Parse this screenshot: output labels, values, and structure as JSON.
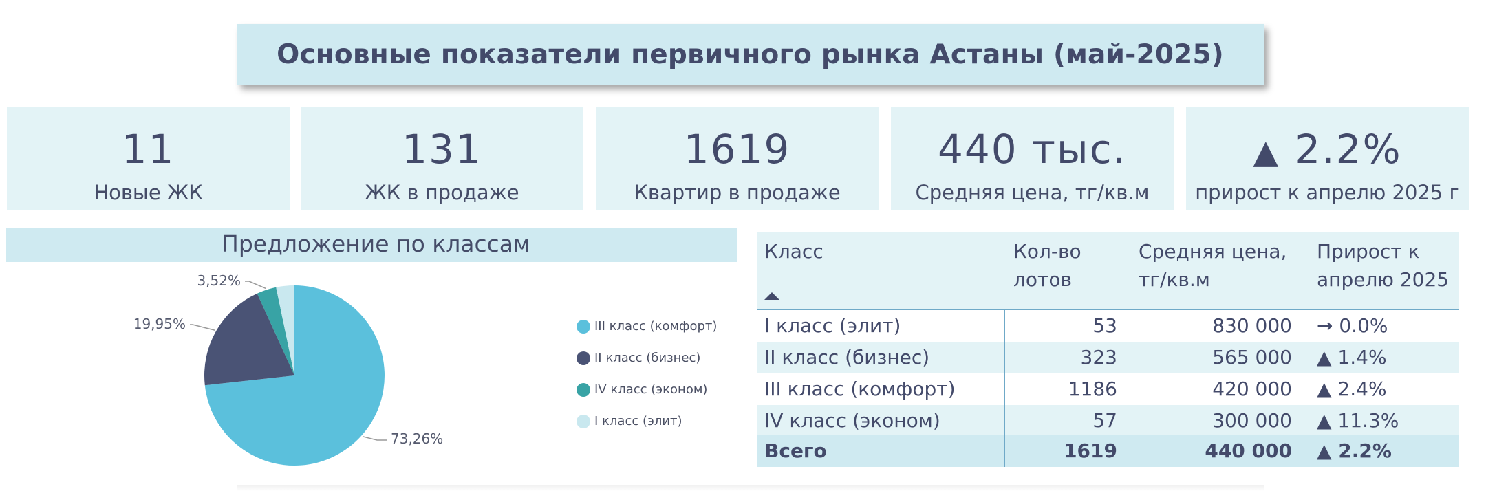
{
  "title": "Основные показатели первичного рынка Астаны (май-2025)",
  "kpis": [
    {
      "value": "11",
      "label": "Новые ЖК"
    },
    {
      "value": "131",
      "label": "ЖК в продаже"
    },
    {
      "value": "1619",
      "label": "Квартир в продаже"
    },
    {
      "value": "440 тыс.",
      "label": "Средняя цена, тг/кв.м"
    },
    {
      "value": "2.2%",
      "label": "прирост к апрелю 2025 г",
      "trend_icon": "▲"
    }
  ],
  "section": {
    "title": "Предложение по классам"
  },
  "colors": {
    "comfort": "#5bc0dc",
    "business": "#4a5375",
    "econom": "#38a3a5",
    "elite": "#c9e8ef",
    "banner": "#cfeaf1",
    "card": "#e3f3f6"
  },
  "legend": [
    {
      "label": "III класс (комфорт)",
      "color": "#5bc0dc"
    },
    {
      "label": "II класс (бизнес)",
      "color": "#4a5375"
    },
    {
      "label": "IV класс (эконом)",
      "color": "#38a3a5"
    },
    {
      "label": "I класс (элит)",
      "color": "#c9e8ef"
    }
  ],
  "chart_data": {
    "type": "pie",
    "title": "Предложение по классам",
    "categories": [
      "III класс (комфорт)",
      "II класс (бизнес)",
      "IV класс (эконом)",
      "I класс (элит)"
    ],
    "values": [
      73.26,
      19.95,
      3.52,
      3.27
    ],
    "labels": [
      "73,26%",
      "19,95%",
      "3,52%",
      ""
    ],
    "colors": [
      "#5bc0dc",
      "#4a5375",
      "#38a3a5",
      "#c9e8ef"
    ],
    "legend_position": "right"
  },
  "table": {
    "headers": {
      "class_line1": "Класс",
      "count_line1": "Кол-во",
      "count_line2": "лотов",
      "price_line1": "Средняя цена,",
      "price_line2": "тг/кв.м",
      "growth_line1": "Прирост к",
      "growth_line2": "апрелю 2025"
    },
    "rows": [
      {
        "cls": "I класс (элит)",
        "count": "53",
        "price": "830 000",
        "growth": "→ 0.0%"
      },
      {
        "cls": "II класс (бизнес)",
        "count": "323",
        "price": "565 000",
        "growth": "▲ 1.4%"
      },
      {
        "cls": "III класс (комфорт)",
        "count": "1186",
        "price": "420 000",
        "growth": "▲ 2.4%"
      },
      {
        "cls": "IV класс (эконом)",
        "count": "57",
        "price": "300 000",
        "growth": "▲ 11.3%"
      }
    ],
    "total": {
      "cls": "Всего",
      "count": "1619",
      "price": "440 000",
      "growth": "▲ 2.2%"
    }
  }
}
